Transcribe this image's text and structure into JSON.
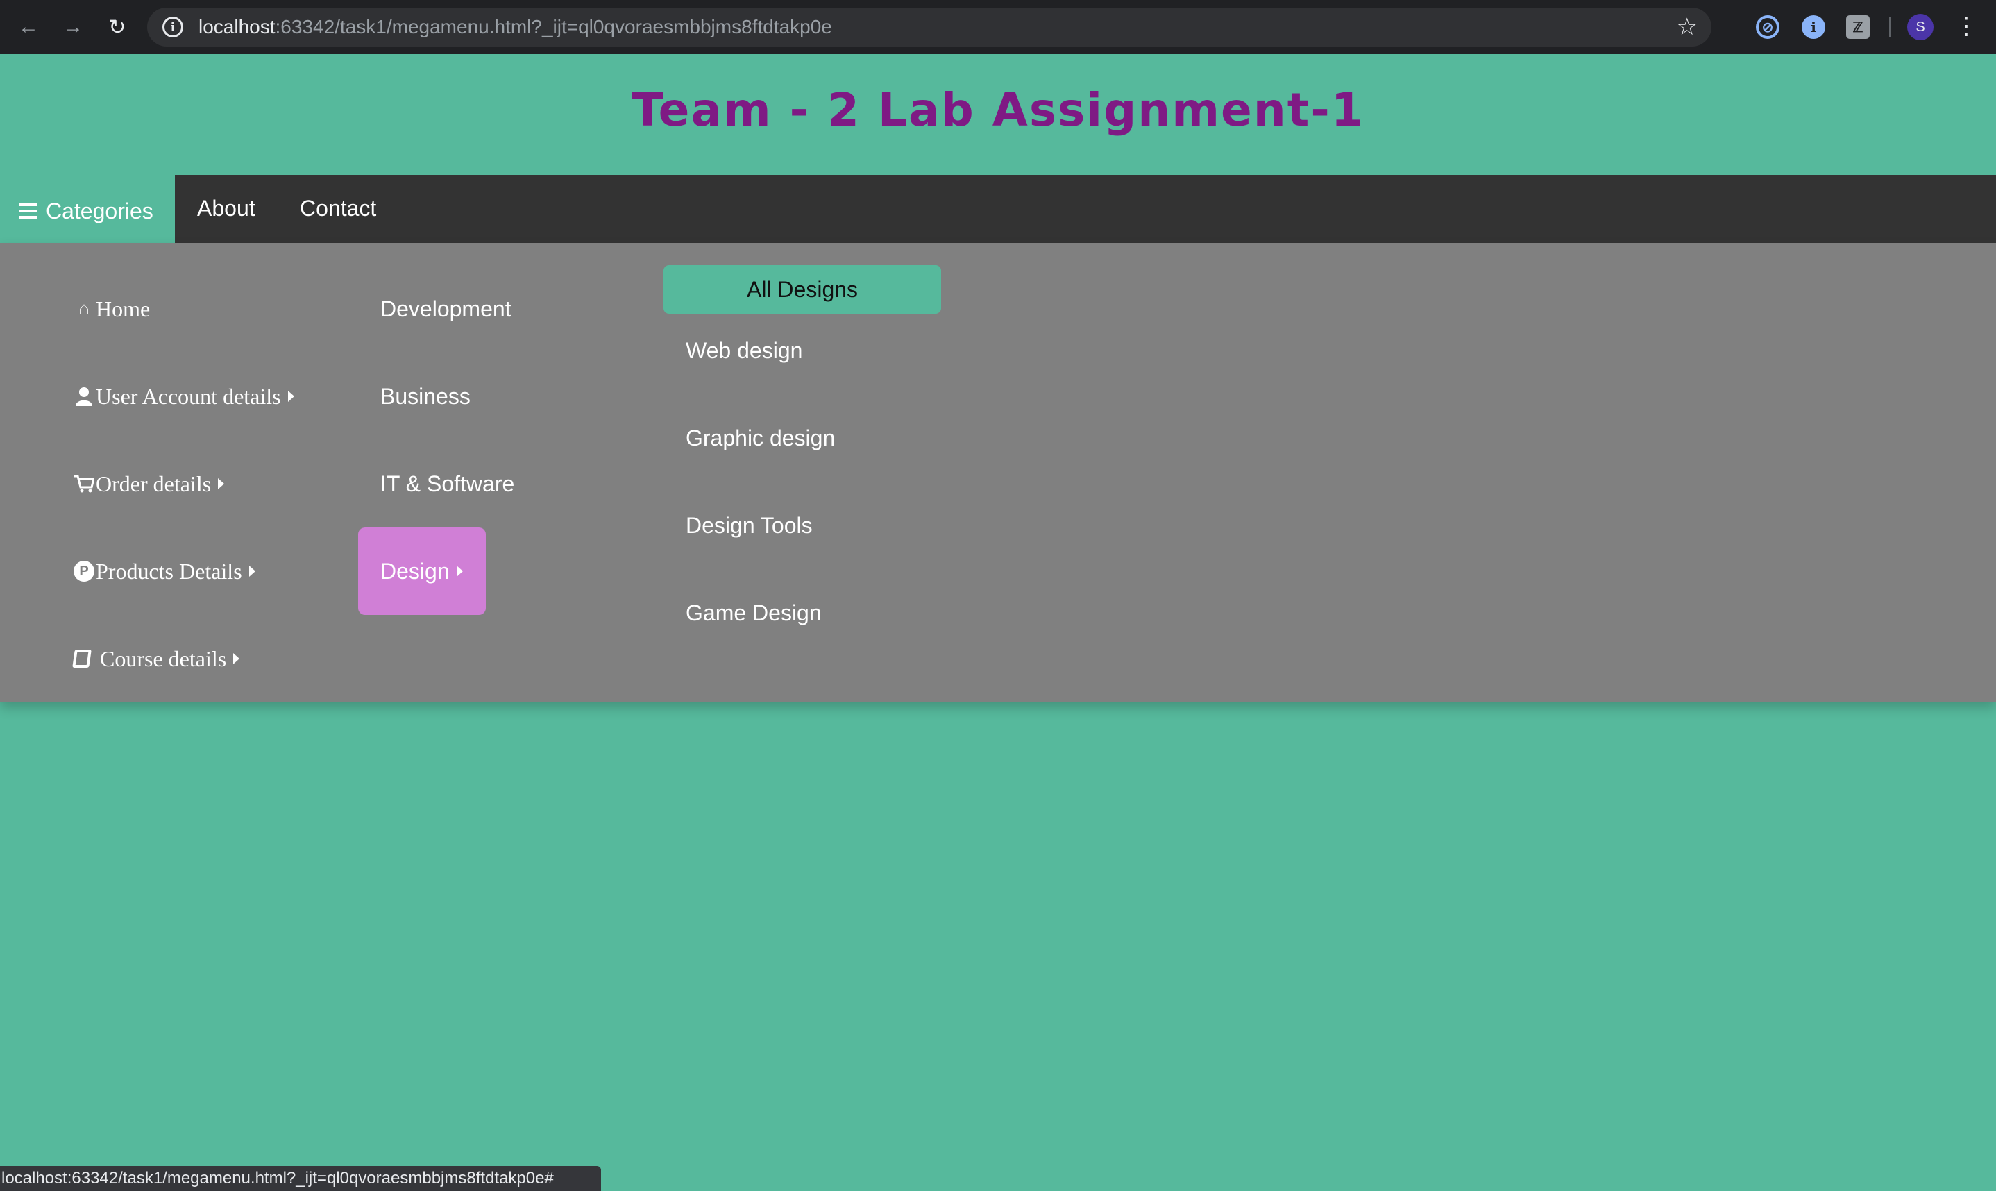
{
  "browser": {
    "url_host": "localhost",
    "url_rest": ":63342/task1/megamenu.html?_ijt=ql0qvoraesmbbjms8ftdtakp0e",
    "profile_initial": "S",
    "status_url": "localhost:63342/task1/megamenu.html?_ijt=ql0qvoraesmbbjms8ftdtakp0e#"
  },
  "page": {
    "title": "Team - 2 Lab Assignment-1"
  },
  "navbar": {
    "categories_label": "Categories",
    "links": [
      "About",
      "Contact"
    ]
  },
  "mega_menu": {
    "column1": [
      {
        "label": "Home",
        "icon": "home-icon",
        "has_submenu": false
      },
      {
        "label": "User Account details",
        "icon": "user-icon",
        "has_submenu": true
      },
      {
        "label": "Order details",
        "icon": "cart-icon",
        "has_submenu": true
      },
      {
        "label": "Products Details",
        "icon": "product-p-icon",
        "has_submenu": true
      },
      {
        "label": "Course details",
        "icon": "book-icon",
        "has_submenu": true
      }
    ],
    "column2": [
      {
        "label": "Development"
      },
      {
        "label": "Business"
      },
      {
        "label": "IT & Software"
      },
      {
        "label": "Design",
        "active": true,
        "has_submenu": true
      }
    ],
    "column3": {
      "header": "All Designs",
      "items": [
        "Web design",
        "Graphic design",
        "Design Tools",
        "Game Design"
      ]
    }
  },
  "colors": {
    "page_bg": "#56b99c",
    "title": "#7f1a84",
    "navbar_bg": "#333333",
    "mega_bg": "#808080",
    "active_item": "#d07fd6"
  }
}
